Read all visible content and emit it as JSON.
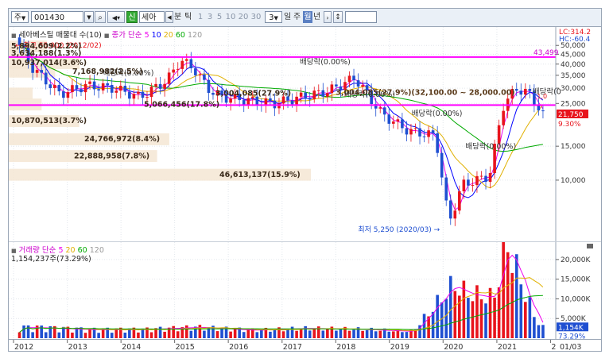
{
  "toolbar": {
    "market_label": "주",
    "code_value": "001430",
    "sign_label": "신",
    "stock_name": "세아",
    "period_prefix_label": "분",
    "tick_label": "틱",
    "interval_options": [
      "1",
      "3",
      "5",
      "10",
      "20",
      "30"
    ],
    "selected_interval": "3",
    "period_tabs": [
      "일",
      "주",
      "월",
      "년"
    ],
    "selected_period": "월"
  },
  "price_panel": {
    "legend_title": "세아베스틸 매물대 수(10)",
    "legend_ma_label": "종가 단순",
    "ma_periods": [
      "5",
      "10",
      "20",
      "60",
      "120"
    ],
    "ma_colors": [
      "#ee00ee",
      "#0000ff",
      "#ffcc00",
      "#00aa00",
      "#999999"
    ],
    "lc_label": "LC:314.2",
    "hc_label": "HC:-60.4",
    "y_ticks": [
      "50,000",
      "45,000",
      "40,000",
      "35,000",
      "30,000",
      "25,000",
      "15,000",
      "10,000"
    ],
    "y_tick_values": [
      50000,
      45000,
      40000,
      35000,
      30000,
      25000,
      15000,
      10000
    ],
    "level_high_label": "43,499",
    "current_price_label": "21,750",
    "current_change_label": "9.30%",
    "max_annotation": "최고 55,000 (2012/02)",
    "min_annotation": "최저 5,250 (2020/03)",
    "range_annotation": "3,004,085(27.9%)(32,100.00 ~ 28,000.00)",
    "dividend_label": "배당락(0.00%)",
    "dividend_partial_label": "배당락(0",
    "misc_top_label": "1,0",
    "volume_profile": [
      {
        "label": "5,894,609(2.2%)",
        "value": 5894609,
        "pct": 2.2
      },
      {
        "label": "3,634,188(1.3%)",
        "value": 3634188,
        "pct": 1.3
      },
      {
        "label": "10,937,014(3.6%)",
        "value": 10937014,
        "pct": 3.6
      },
      {
        "label": "7,168,982(2.5%)",
        "value": 7168982,
        "pct": 2.5
      },
      {
        "label": "3,004,085(27.9%)",
        "value": 3004085,
        "pct": 27.9
      },
      {
        "label": "5,066,456(17.8%)",
        "value": 5066456,
        "pct": 17.8
      },
      {
        "label": "10,870,513(3.7%)",
        "value": 10870513,
        "pct": 3.7
      },
      {
        "label": "24,766,972(8.4%)",
        "value": 24766972,
        "pct": 8.4
      },
      {
        "label": "22,888,958(7.8%)",
        "value": 22888958,
        "pct": 7.8
      },
      {
        "label": "46,613,137(15.9%)",
        "value": 46613137,
        "pct": 15.9
      }
    ]
  },
  "volume_panel": {
    "legend_title": "거래량",
    "legend_ma_label": "단순",
    "ma_periods": [
      "5",
      "20",
      "60",
      "120"
    ],
    "ma_colors": [
      "#ee00ee",
      "#ffcc00",
      "#00aa00",
      "#999999"
    ],
    "current_volume_label": "1,154,237주(73.29%)",
    "y_ticks": [
      "20,000K",
      "15,000K",
      "10,000K",
      "5,000K"
    ],
    "y_tick_values": [
      20000000,
      15000000,
      10000000,
      5000000
    ],
    "current_volume_box": "1,154K",
    "current_ratio_label": "73.29%"
  },
  "x_axis": {
    "labels": [
      "2012",
      "2013",
      "2014",
      "2015",
      "2016",
      "2017",
      "2018",
      "2019",
      "2020",
      "2021",
      "2"
    ],
    "end_label": "01/03"
  },
  "colors": {
    "up": "#e8141c",
    "down": "#1f4fd1",
    "level_line": "#ff00ff",
    "volume_profile": "#f5e6d3",
    "accent": "#ff0000"
  },
  "chart_data": {
    "type": "candlestick",
    "title": "세아베스틸 매물대 수(10)",
    "xlabel": "",
    "ylabel": "",
    "x_range": [
      "2012-01",
      "2022-01"
    ],
    "y_range": [
      5000,
      55000
    ],
    "y_scale": "log",
    "grid": true,
    "price_series": {
      "x": [
        "2012-02",
        "2012-06",
        "2012-12",
        "2013-06",
        "2013-12",
        "2014-06",
        "2014-12",
        "2015-03",
        "2015-06",
        "2015-09",
        "2015-12",
        "2016-06",
        "2016-12",
        "2017-06",
        "2017-12",
        "2018-06",
        "2018-12",
        "2019-06",
        "2019-12",
        "2020-03",
        "2020-06",
        "2020-12",
        "2021-03",
        "2021-06",
        "2021-09",
        "2021-12"
      ],
      "close": [
        55000,
        38000,
        28000,
        31000,
        30000,
        27000,
        33000,
        42000,
        38000,
        30000,
        27000,
        26000,
        25000,
        27000,
        29000,
        34000,
        22000,
        18000,
        17000,
        6000,
        9500,
        10500,
        24000,
        30000,
        28000,
        21750
      ]
    },
    "volume_series": {
      "x": [
        "2012-06",
        "2013-06",
        "2014-06",
        "2015-06",
        "2016-06",
        "2017-06",
        "2018-06",
        "2019-06",
        "2020-03",
        "2020-06",
        "2020-12",
        "2021-03",
        "2021-06",
        "2021-09",
        "2021-12"
      ],
      "volume": [
        2500000,
        2000000,
        2000000,
        2500000,
        1800000,
        2200000,
        2000000,
        1500000,
        12000000,
        10000000,
        9000000,
        21000000,
        13000000,
        5000000,
        1154237
      ]
    },
    "level_lines": [
      43499,
      24500
    ],
    "annotations": [
      "최고 55,000 (2012/02)",
      "최저 5,250 (2020/03)",
      "배당락(0.00%)"
    ]
  }
}
